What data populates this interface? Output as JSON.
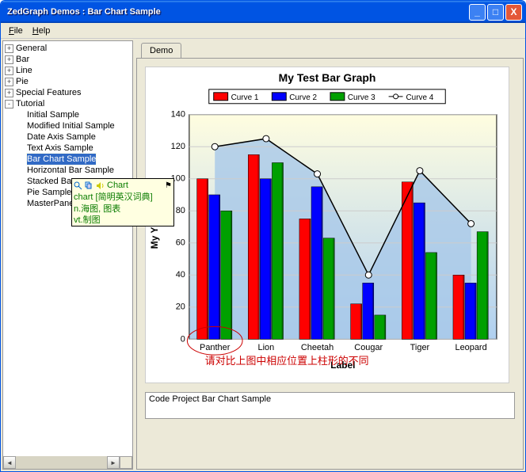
{
  "window": {
    "title": "ZedGraph Demos : Bar Chart Sample"
  },
  "menu": {
    "file": "File",
    "help": "Help"
  },
  "tree": {
    "top": [
      {
        "exp": "+",
        "label": "General"
      },
      {
        "exp": "+",
        "label": "Bar"
      },
      {
        "exp": "+",
        "label": "Line"
      },
      {
        "exp": "+",
        "label": "Pie"
      },
      {
        "exp": "+",
        "label": "Special Features"
      },
      {
        "exp": "-",
        "label": "Tutorial"
      }
    ],
    "tutorial": [
      "Initial Sample",
      "Modified Initial Sample",
      "Date Axis Sample",
      "Text Axis Sample",
      "Bar Chart Sample",
      "Horizontal Bar Sample",
      "Stacked Ba",
      "Pie Sample",
      "MasterPane"
    ],
    "selected": "Bar Chart Sample"
  },
  "tooltip": {
    "word": "Chart",
    "line1": "chart [简明英汉词典]",
    "line2": "n.海图, 图表",
    "line3": "vt.制图"
  },
  "tabs": {
    "demo": "Demo"
  },
  "status": "Code Project Bar Chart Sample",
  "annotation": "请对比上图中相应位置上柱形的不同",
  "chart_data": {
    "type": "bar+line",
    "title": "My Test Bar Graph",
    "xlabel": "Label",
    "ylabel": "My Y Axis",
    "ylim": [
      0,
      140
    ],
    "yticks": [
      0,
      20,
      40,
      60,
      80,
      100,
      120,
      140
    ],
    "categories": [
      "Panther",
      "Lion",
      "Cheetah",
      "Cougar",
      "Tiger",
      "Leopard"
    ],
    "series": [
      {
        "name": "Curve 1",
        "type": "bar",
        "color": "#ff0000",
        "values": [
          100,
          115,
          75,
          22,
          98,
          40
        ]
      },
      {
        "name": "Curve 2",
        "type": "bar",
        "color": "#0000ff",
        "values": [
          90,
          100,
          95,
          35,
          85,
          35
        ]
      },
      {
        "name": "Curve 3",
        "type": "bar",
        "color": "#00a000",
        "values": [
          80,
          110,
          63,
          15,
          54,
          67
        ]
      },
      {
        "name": "Curve 4",
        "type": "line",
        "color": "#000000",
        "values": [
          120,
          125,
          103,
          40,
          105,
          72
        ]
      }
    ]
  }
}
